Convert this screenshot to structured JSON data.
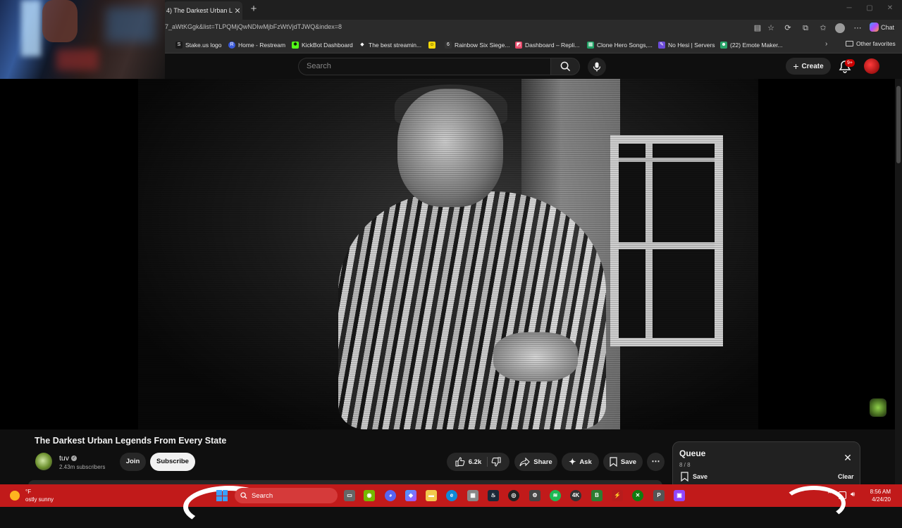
{
  "browser": {
    "active_tab_title": "4) The Darkest Urban Lege",
    "url": "7_aWtKGgk&list=TLPQMjQwNDIwMjbFzWtVjdTJWQ&index=8",
    "chat_label": "Chat",
    "bookmarks": [
      {
        "label": "Stake.us logo",
        "color": "#1a1a1a"
      },
      {
        "label": "Home - Restream",
        "color": "#3b5bdb"
      },
      {
        "label": "KickBot Dashboard",
        "color": "#53fc18"
      },
      {
        "label": "The best streamin...",
        "color": "#ffffff"
      },
      {
        "label": "",
        "color": "#f5d90a"
      },
      {
        "label": "Rainbow Six Siege...",
        "color": "#333333"
      },
      {
        "label": "Dashboard – Repli...",
        "color": "#e8496a"
      },
      {
        "label": "Clone Hero Songs,...",
        "color": "#21a366"
      },
      {
        "label": "No Hesi | Servers",
        "color": "#6b4bd8"
      },
      {
        "label": "(22) Emote Maker...",
        "color": "#2aa56a"
      }
    ],
    "other_favorites": "Other favorites"
  },
  "youtube": {
    "search_placeholder": "Search",
    "create_label": "Create",
    "notification_badge": "9+",
    "video_title": "The Darkest Urban Legends From Every State",
    "channel_name": "tuv",
    "subscriber_count": "2.43m subscribers",
    "join_label": "Join",
    "subscribe_label": "Subscribe",
    "like_count": "6.2k",
    "share_label": "Share",
    "ask_label": "Ask",
    "save_label": "Save",
    "queue": {
      "title": "Queue",
      "count": "8 / 8",
      "save_label": "Save",
      "clear_label": "Clear"
    }
  },
  "taskbar": {
    "weather_temp": "°F",
    "weather_condition": "ostly sunny",
    "search_placeholder": "Search",
    "time": "8:56 AM",
    "date": "4/24/20"
  },
  "icons": {
    "search": "search-icon",
    "mic": "mic-icon",
    "bell": "bell-icon",
    "like": "thumbs-up-icon",
    "dislike": "thumbs-down-icon",
    "share": "share-icon",
    "ask": "sparkle-icon",
    "save": "bookmark-icon"
  },
  "colors": {
    "yt_background": "#0f0f0f",
    "taskbar": "#c11a1a",
    "subscribe_bg": "#f1f1f1"
  }
}
